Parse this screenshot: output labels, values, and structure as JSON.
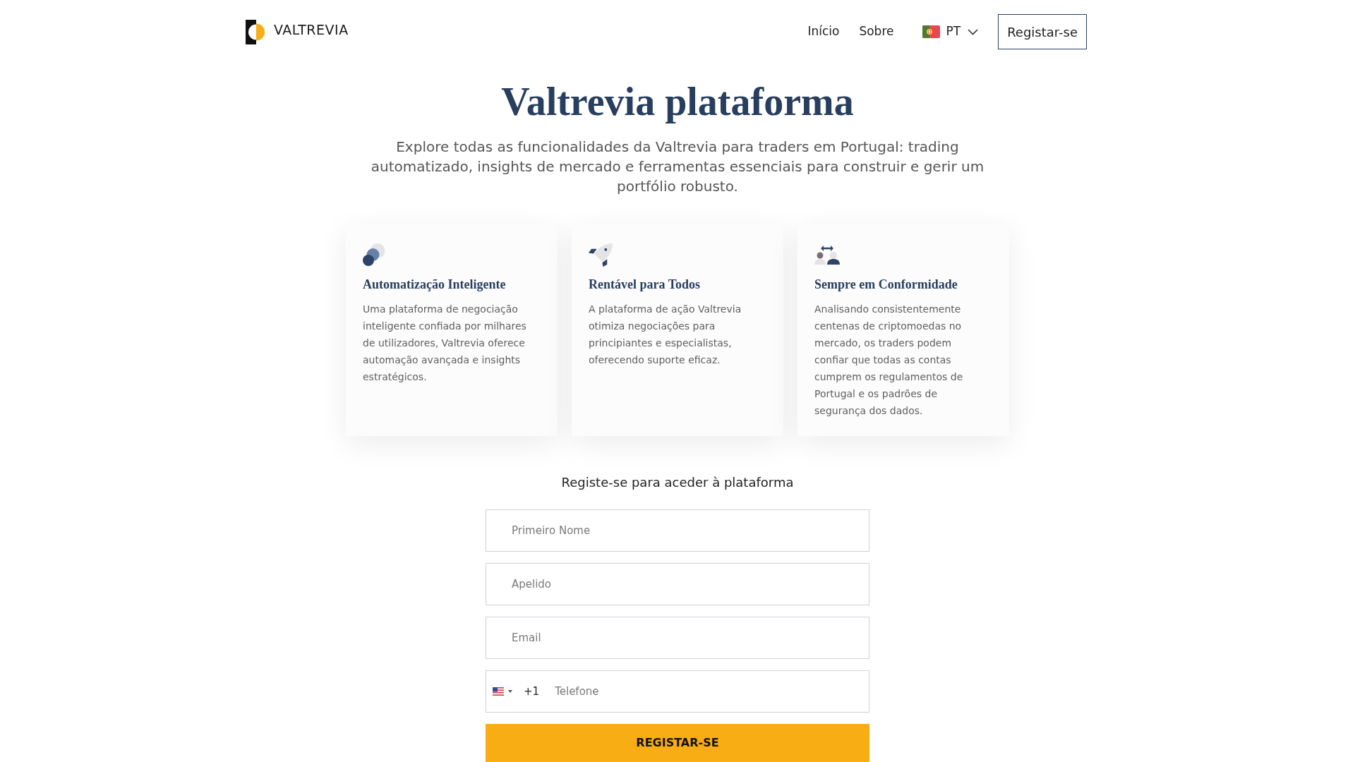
{
  "header": {
    "logo": "VALTREVIA",
    "nav": [
      {
        "label": "Início"
      },
      {
        "label": "Sobre"
      }
    ],
    "language": {
      "code": "PT"
    },
    "cta": "Registar-se"
  },
  "hero": {
    "title": "Valtrevia plataforma",
    "subtitle": "Explore todas as funcionalidades da Valtrevia para traders em Portugal: trading automatizado, insights de mercado e ferramentas essenciais para construir e gerir um portfólio robusto."
  },
  "features": [
    {
      "kind": "circles",
      "title": "Automatização Inteligente",
      "text": "Uma plataforma de negociação inteligente confiada por milhares de utilizadores, Valtrevia oferece automação avançada e insights estratégicos."
    },
    {
      "kind": "rocket",
      "title": "Rentável para Todos",
      "text": "A plataforma de ação Valtrevia otimiza negociações para principiantes e especialistas, oferecendo suporte eficaz."
    },
    {
      "kind": "people",
      "title": "Sempre em Conformidade",
      "text": "Analisando consistentemente centenas de criptomoedas no mercado, os traders podem confiar que todas as contas cumprem os regulamentos de Portugal e os padrões de segurança dos dados."
    }
  ],
  "form": {
    "heading": "Registe-se para aceder à plataforma",
    "fields": [
      {
        "placeholder": "Primeiro Nome"
      },
      {
        "placeholder": "Apelido"
      },
      {
        "placeholder": "Email"
      }
    ],
    "phone": {
      "dial_code": "+1",
      "placeholder": "Telefone"
    },
    "submit": "REGISTAR-SE"
  }
}
